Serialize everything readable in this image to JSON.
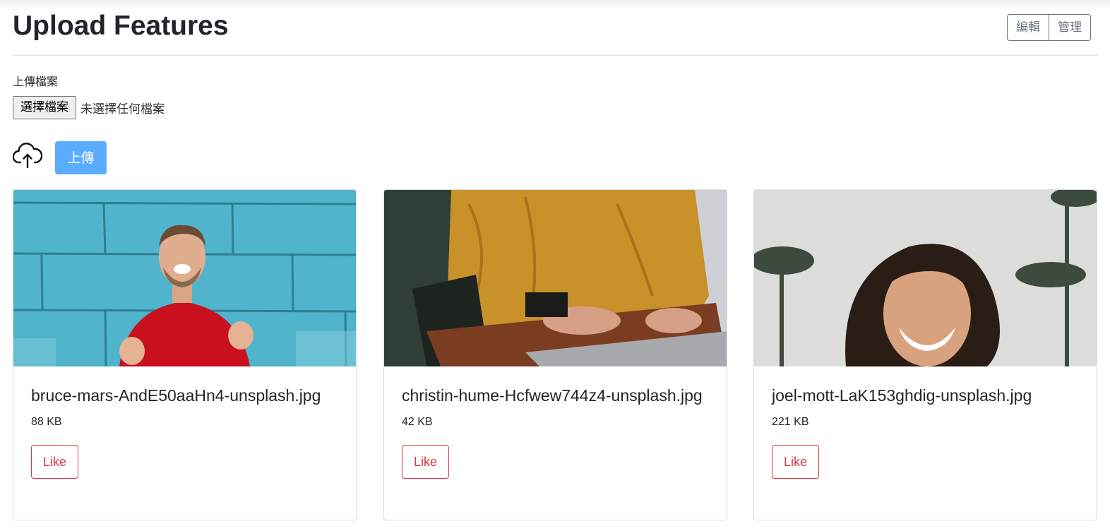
{
  "header": {
    "title": "Upload Features",
    "edit_label": "編輯",
    "manage_label": "管理"
  },
  "upload": {
    "label": "上傳檔案",
    "choose_button": "選擇檔案",
    "no_file_text": "未選擇任何檔案",
    "upload_button": "上傳",
    "accent_color": "#5aacff"
  },
  "cards": [
    {
      "image": "smiling man in red sweater against blue brick wall",
      "name": "bruce-mars-AndE50aaHn4-unsplash.jpg",
      "size": "88 KB",
      "like_label": "Like"
    },
    {
      "image": "person in mustard sweater typing on laptop",
      "name": "christin-hume-Hcfwew744z4-unsplash.jpg",
      "size": "42 KB",
      "like_label": "Like"
    },
    {
      "image": "laughing woman with palm trees behind",
      "name": "joel-mott-LaK153ghdig-unsplash.jpg",
      "size": "221 KB",
      "like_label": "Like"
    }
  ],
  "colors": {
    "like": "#dc3545",
    "secondary": "#6c757d"
  }
}
